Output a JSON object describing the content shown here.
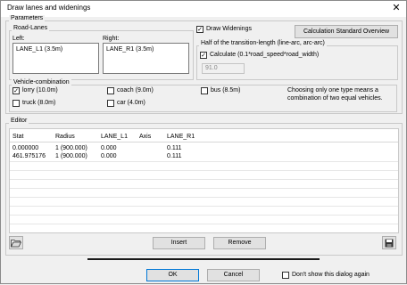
{
  "window": {
    "title": "Draw lanes and widenings",
    "close_glyph": "✕"
  },
  "parameters": {
    "legend": "Parameters",
    "road_lanes": {
      "legend": "Road-Lanes",
      "left_label": "Left:",
      "left_items": [
        "LANE_L1 (3.5m)"
      ],
      "right_label": "Right:",
      "right_items": [
        "LANE_R1 (3.5m)"
      ]
    },
    "draw_widenings": {
      "label": "Draw Widenings",
      "checked": true
    },
    "calc_overview_button": "Calculation Standard Overview",
    "transition": {
      "legend": "Half of the transition-length (line-arc, arc-arc)",
      "calculate_label": "Calculate (0.1*road_speed*road_width)",
      "calculate_checked": true,
      "value": "91.0"
    },
    "vehicle_combination": {
      "legend": "Vehicle-combination",
      "options": [
        {
          "label": "lorry (10.0m)",
          "checked": true
        },
        {
          "label": "coach (9.0m)",
          "checked": false
        },
        {
          "label": "bus (8.5m)",
          "checked": false
        },
        {
          "label": "truck (8.0m)",
          "checked": false
        },
        {
          "label": "car (4.0m)",
          "checked": false
        }
      ],
      "note_line1": "Choosing only one type means a",
      "note_line2": "combination of two equal vehicles."
    }
  },
  "editor": {
    "legend": "Editor",
    "columns": [
      "Stat",
      "Radius",
      "LANE_L1",
      "Axis",
      "LANE_R1"
    ],
    "rows": [
      [
        "0.000000",
        "1 (900.000)",
        "0.000",
        "",
        "0.111"
      ],
      [
        "461.975176",
        "1 (900.000)",
        "0.000",
        "",
        "0.111"
      ]
    ],
    "open_icon": "folder-open-icon",
    "save_icon": "save-icon",
    "insert_button": "Insert",
    "remove_button": "Remove"
  },
  "footer": {
    "ok_button": "OK",
    "cancel_button": "Cancel",
    "dont_show_label": "Don't show this dialog again",
    "dont_show_checked": false
  }
}
